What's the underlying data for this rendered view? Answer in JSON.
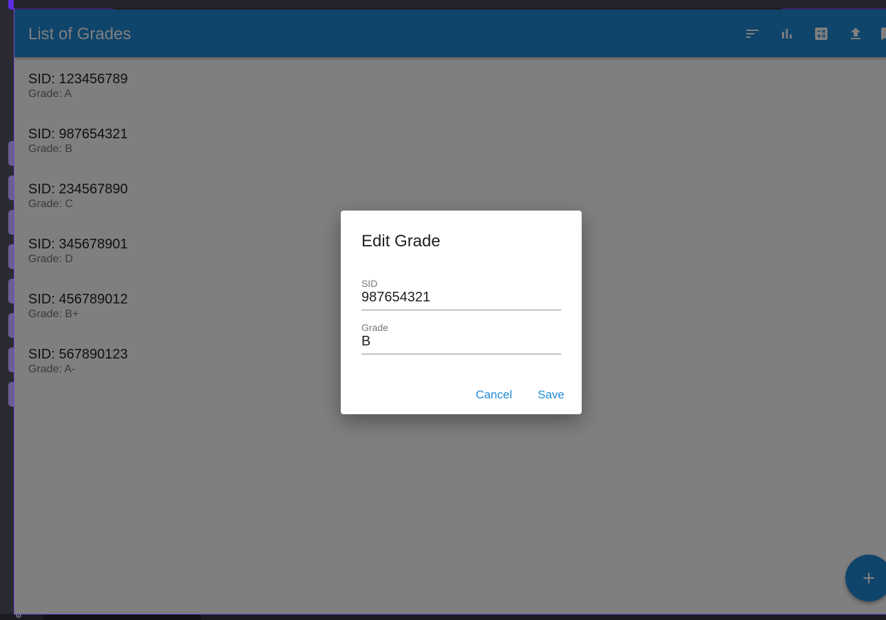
{
  "app": {
    "title": "List of Grades",
    "toolbar_icons": [
      "sort-icon",
      "bar-chart-icon",
      "calculator-icon",
      "upload-icon",
      "bookmark-icon"
    ],
    "accent_color": "#1f89d6"
  },
  "grades": [
    {
      "sid": "SID: 123456789",
      "grade": "Grade: A"
    },
    {
      "sid": "SID: 987654321",
      "grade": "Grade: B"
    },
    {
      "sid": "SID: 234567890",
      "grade": "Grade: C"
    },
    {
      "sid": "SID: 345678901",
      "grade": "Grade: D"
    },
    {
      "sid": "SID: 456789012",
      "grade": "Grade: B+"
    },
    {
      "sid": "SID: 567890123",
      "grade": "Grade: A-"
    }
  ],
  "fab": {
    "icon": "add-icon"
  },
  "dialog": {
    "title": "Edit Grade",
    "sid_label": "SID",
    "sid_value": "987654321",
    "grade_label": "Grade",
    "grade_value": "B",
    "cancel_label": "Cancel",
    "save_label": "Save"
  }
}
